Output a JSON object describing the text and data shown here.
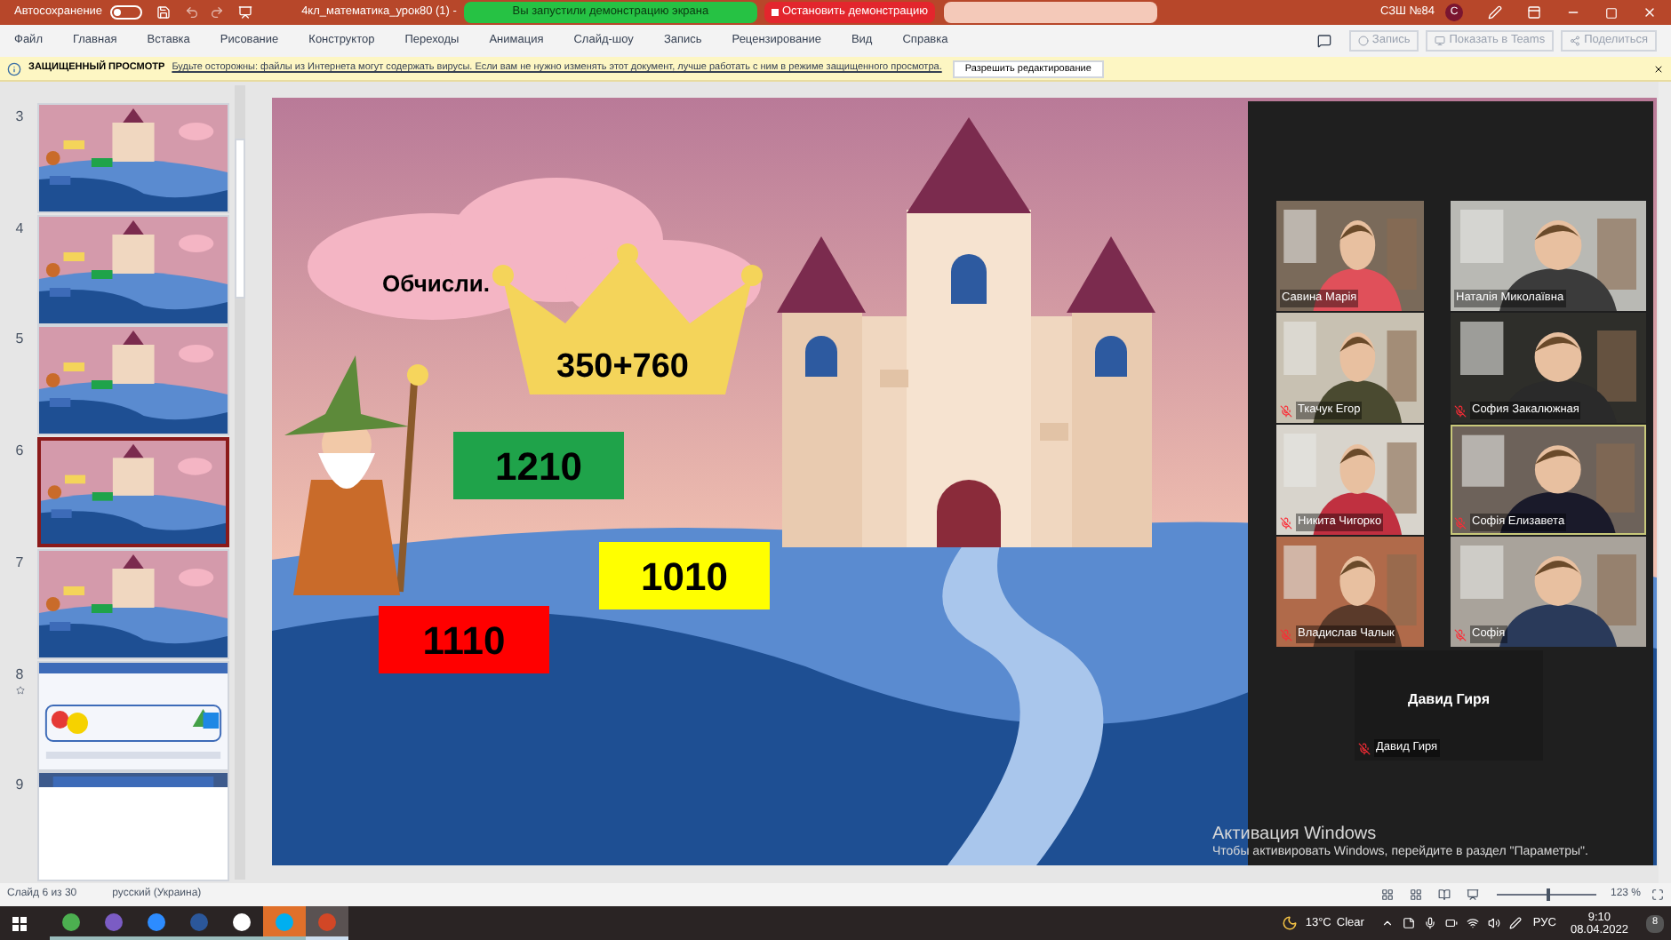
{
  "title_bar": {
    "autosave_label": "Автосохранение",
    "autosave_on": false,
    "file_name": "4кл_математика_урок80 (1) -",
    "share_banner": "Вы запустили демонстрацию экрана",
    "stop_button": "Остановить демонстрацию",
    "account": "СЗШ №84",
    "avatar": "С"
  },
  "ribbon_tabs": [
    {
      "label": "Файл",
      "selected": false
    },
    {
      "label": "Главная",
      "selected": false
    },
    {
      "label": "Вставка",
      "selected": false
    },
    {
      "label": "Рисование",
      "selected": false
    },
    {
      "label": "Конструктор",
      "selected": false
    },
    {
      "label": "Переходы",
      "selected": false
    },
    {
      "label": "Анимация",
      "selected": false
    },
    {
      "label": "Слайд-шоу",
      "selected": false
    },
    {
      "label": "Запись",
      "selected": false
    },
    {
      "label": "Рецензирование",
      "selected": false
    },
    {
      "label": "Вид",
      "selected": false
    },
    {
      "label": "Справка",
      "selected": false
    }
  ],
  "ribbon_buttons": [
    {
      "kind": "record",
      "label": "Запись"
    },
    {
      "kind": "teams",
      "label": "Показать в Teams"
    },
    {
      "kind": "share",
      "label": "Поделиться"
    }
  ],
  "protected_view": {
    "title": "ЗАЩИЩЕННЫЙ ПРОСМОТР",
    "message": "Будьте осторожны: файлы из Интернета могут содержать вирусы. Если вам не нужно изменять этот документ, лучше работать с ним в режиме защищенного просмотра.",
    "button": "Разрешить редактирование"
  },
  "slides": [
    {
      "number": "3",
      "kind": "castle",
      "selected": false,
      "animated": false
    },
    {
      "number": "4",
      "kind": "castle",
      "selected": false,
      "animated": false
    },
    {
      "number": "5",
      "kind": "castle",
      "selected": false,
      "animated": false
    },
    {
      "number": "6",
      "kind": "castle",
      "selected": true,
      "animated": false
    },
    {
      "number": "7",
      "kind": "castle",
      "selected": false,
      "animated": false
    },
    {
      "number": "8",
      "kind": "worksheet",
      "selected": false,
      "animated": true
    },
    {
      "number": "9",
      "kind": "title",
      "selected": false,
      "animated": false
    }
  ],
  "slide": {
    "heading": "Обчисли.",
    "expression": "350+760",
    "answers": [
      {
        "text": "1210",
        "color": "#1fa34a"
      },
      {
        "text": "1010",
        "color": "#ffff00"
      },
      {
        "text": "1110",
        "color": "#ff0000"
      }
    ]
  },
  "participants": [
    {
      "name": "Савина Марія",
      "kind": "video",
      "muted": false,
      "selected": false
    },
    {
      "name": "Наталія Миколаївна",
      "kind": "video",
      "muted": false,
      "selected": false
    },
    {
      "name": "Ткачук Егор",
      "kind": "video",
      "muted": true,
      "selected": false
    },
    {
      "name": "София Закалюжная",
      "kind": "video",
      "muted": true,
      "selected": false
    },
    {
      "name": "Никита Чигорко",
      "kind": "video",
      "muted": true,
      "selected": false
    },
    {
      "name": "Софія Елизавета",
      "kind": "video",
      "muted": true,
      "selected": true
    },
    {
      "name": "Владислав Чалык",
      "kind": "video",
      "muted": true,
      "selected": false
    },
    {
      "name": "Софія",
      "kind": "video",
      "muted": true,
      "selected": false
    },
    {
      "name": "Давид Гиря",
      "kind": "name",
      "caption": "Давид Гиря",
      "muted": true,
      "selected": false
    }
  ],
  "activation": {
    "title": "Активация Windows",
    "text": "Чтобы активировать Windows, перейдите в раздел \"Параметры\"."
  },
  "status_bar": {
    "slide": "Слайд 6 из 30",
    "language": "русский (Украина)",
    "zoom": "123 %",
    "level": 0.5
  },
  "taskbar": {
    "apps": [
      {
        "kind": "chrome",
        "active": false,
        "flashing": false
      },
      {
        "kind": "viber",
        "active": false,
        "flashing": false
      },
      {
        "kind": "zoom",
        "active": false,
        "flashing": false
      },
      {
        "kind": "word",
        "active": false,
        "flashing": false
      },
      {
        "kind": "yandex",
        "active": false,
        "flashing": false
      },
      {
        "kind": "skype",
        "active": false,
        "flashing": true
      },
      {
        "kind": "powerpoint",
        "active": true,
        "flashing": false
      }
    ],
    "temperature": "13°C",
    "weather": "Clear",
    "language": "РУС",
    "time": "9:10",
    "date": "08.04.2022",
    "notifications": "8"
  }
}
